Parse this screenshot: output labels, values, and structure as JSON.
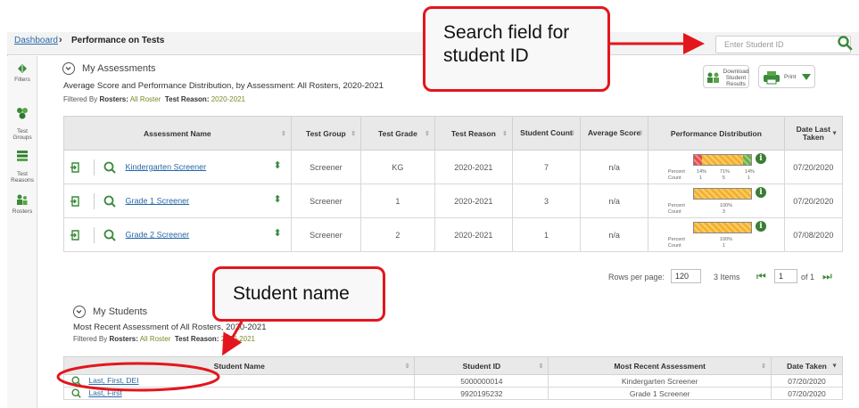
{
  "breadcrumb": {
    "home": "Dashboard",
    "separator": "›",
    "current": "Performance on Tests"
  },
  "search": {
    "placeholder": "Enter Student ID"
  },
  "sidebar": {
    "items": [
      {
        "label": "Filters",
        "icon": "filters-icon"
      },
      {
        "label": "Test\nGroups",
        "icon": "test-groups-icon"
      },
      {
        "label": "Test\nReasons",
        "icon": "test-reasons-icon"
      },
      {
        "label": "Rosters",
        "icon": "rosters-icon"
      }
    ]
  },
  "assessments": {
    "title": "My Assessments",
    "subtitle": "Average Score and Performance Distribution, by Assessment: All Rosters, 2020-2021",
    "filter_prefix": "Filtered By",
    "filter_rosters_label": "Rosters:",
    "filter_rosters_value": "All Roster",
    "filter_reason_label": "Test Reason:",
    "filter_reason_value": "2020-2021",
    "download_label": "Download\nStudent Results",
    "print_label": "Print",
    "columns": [
      "Assessment Name",
      "Test Group",
      "Test Grade",
      "Test Reason",
      "Student Count",
      "Average Score",
      "Performance Distribution",
      "Date Last Taken"
    ],
    "rows": [
      {
        "name": "Kindergarten Screener",
        "group": "Screener",
        "grade": "KG",
        "reason": "2020-2021",
        "count": "7",
        "avg": "n/a",
        "dist": {
          "percent_label": "Percent",
          "count_label": "Count",
          "percents": [
            "14%",
            "71%",
            "14%"
          ],
          "counts": [
            "1",
            "5",
            "1"
          ],
          "fractions": [
            0.14,
            0.72,
            0.14
          ]
        },
        "date": "07/20/2020"
      },
      {
        "name": "Grade 1 Screener",
        "group": "Screener",
        "grade": "1",
        "reason": "2020-2021",
        "count": "3",
        "avg": "n/a",
        "dist": {
          "percent_label": "Percent",
          "count_label": "Count",
          "percents": [
            "100%"
          ],
          "counts": [
            "3"
          ],
          "fractions": [
            0,
            1,
            0
          ]
        },
        "date": "07/20/2020"
      },
      {
        "name": "Grade 2 Screener",
        "group": "Screener",
        "grade": "2",
        "reason": "2020-2021",
        "count": "1",
        "avg": "n/a",
        "dist": {
          "percent_label": "Percent",
          "count_label": "Count",
          "percents": [
            "100%"
          ],
          "counts": [
            "1"
          ],
          "fractions": [
            0,
            1,
            0
          ]
        },
        "date": "07/08/2020"
      }
    ],
    "pager": {
      "rows_label": "Rows per page:",
      "rows_value": "120",
      "items": "3 Items",
      "page": "1",
      "of": "of 1"
    }
  },
  "students": {
    "title": "My Students",
    "subtitle": "Most Recent Assessment of All Rosters, 2020-2021",
    "filter_prefix": "Filtered By",
    "filter_rosters_label": "Rosters:",
    "filter_rosters_value": "All Roster",
    "filter_reason_label": "Test Reason:",
    "filter_reason_value": "2020-2021",
    "columns": [
      "Student Name",
      "Student ID",
      "Most Recent Assessment",
      "Date Taken"
    ],
    "rows": [
      {
        "name": "Last, First, DEI",
        "id": "5000000014",
        "assessment": "Kindergarten Screener",
        "date": "07/20/2020"
      },
      {
        "name": "Last, First",
        "id": "9920195232",
        "assessment": "Grade 1 Screener",
        "date": "07/20/2020"
      }
    ]
  },
  "callouts": {
    "search": "Search field for\nstudent ID",
    "student": "Student name"
  },
  "colors": {
    "callout_border": "#e3161d",
    "link": "#2a6aa6",
    "filter_value": "#7a8a2a",
    "bar_low": "#e84a4a",
    "bar_mid": "#f5b02a",
    "bar_high": "#66b04a",
    "info": "#3a7d33"
  }
}
